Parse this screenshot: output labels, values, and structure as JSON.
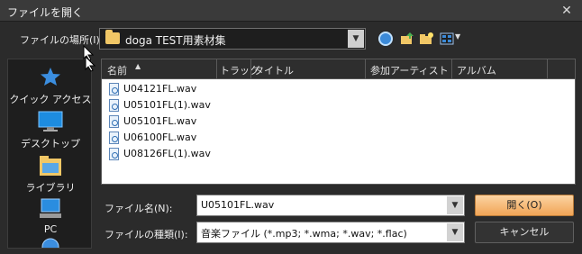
{
  "window": {
    "title": "ファイルを開く",
    "close_glyph": "✕"
  },
  "lookin": {
    "label": "ファイルの場所(I):",
    "value": "doga TEST用素材集"
  },
  "toolbar": {
    "icons": [
      "back-icon",
      "up-folder-icon",
      "new-folder-icon",
      "view-menu-icon"
    ]
  },
  "places": [
    {
      "label": "クイック アクセス",
      "icon": "star-icon"
    },
    {
      "label": "デスクトップ",
      "icon": "desktop-icon"
    },
    {
      "label": "ライブラリ",
      "icon": "library-icon"
    },
    {
      "label": "PC",
      "icon": "pc-icon"
    }
  ],
  "columns": [
    "名前",
    "トラック",
    "タイトル",
    "参加アーティスト",
    "アルバム"
  ],
  "files": [
    "U04121FL.wav",
    "U05101FL(1).wav",
    "U05101FL.wav",
    "U06100FL.wav",
    "U08126FL(1).wav"
  ],
  "filename": {
    "label": "ファイル名(N):",
    "value": "U05101FL.wav"
  },
  "filetype": {
    "label": "ファイルの種類(I):",
    "value": "音楽ファイル (*.mp3; *.wma; *.wav; *.flac)"
  },
  "buttons": {
    "open": "開く(O)",
    "cancel": "キャンセル"
  },
  "colors": {
    "accent": "#f1a556",
    "background": "#2b2b2b"
  }
}
